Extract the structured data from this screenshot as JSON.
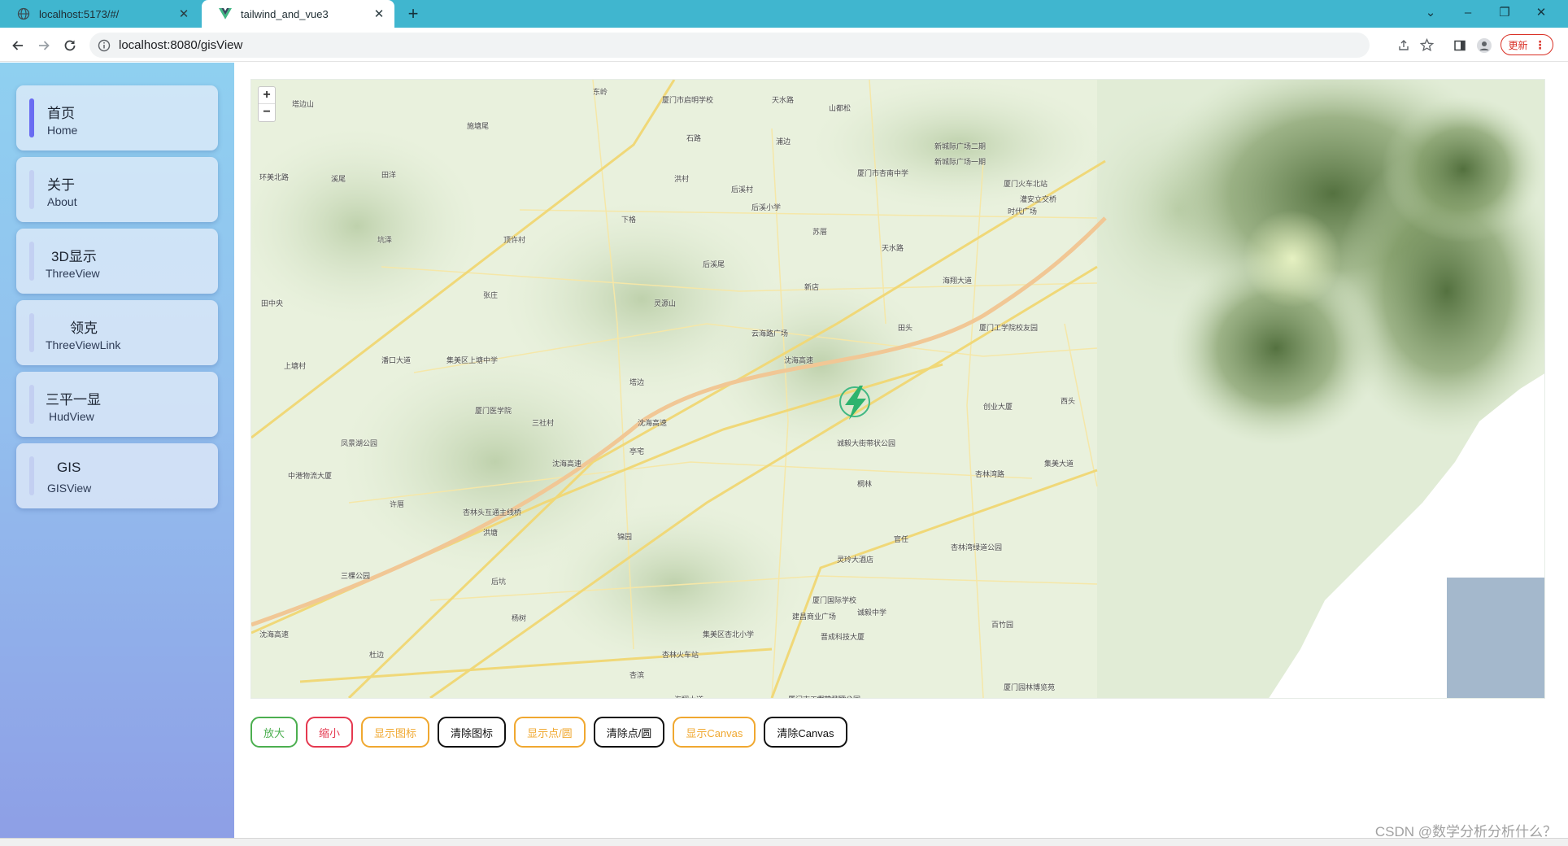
{
  "browser": {
    "tabs": [
      {
        "title": "localhost:5173/#/",
        "active": false
      },
      {
        "title": "tailwind_and_vue3",
        "active": true
      }
    ],
    "address": "localhost:8080/gisView",
    "update_label": "更新"
  },
  "sidebar": {
    "items": [
      {
        "title": "首页",
        "subtitle": "Home",
        "active": true
      },
      {
        "title": "关于",
        "subtitle": "About",
        "active": false
      },
      {
        "title": "3D显示",
        "subtitle": "ThreeView",
        "active": false
      },
      {
        "title": "领克",
        "subtitle": "ThreeViewLink",
        "active": false
      },
      {
        "title": "三平一显",
        "subtitle": "HudView",
        "active": false
      },
      {
        "title": "GIS",
        "subtitle": "GISView",
        "active": false
      }
    ]
  },
  "map": {
    "zoom_in": "+",
    "zoom_out": "−",
    "marker_icon": "lightning-icon",
    "labels": [
      "塔边山",
      "东岭",
      "厦门市启明学校",
      "天水路",
      "山都松",
      "施塘尾",
      "石路",
      "浦边",
      "新城际广场二期",
      "新城际广场一期",
      "厦门市杏南中学",
      "厦门火车北站",
      "灌安立交桥",
      "时代广场",
      "环美北路",
      "溪尾",
      "田洋",
      "后溪村",
      "后溪小学",
      "洪村",
      "苏厝",
      "坑泽",
      "顶许村",
      "下格",
      "天水路",
      "后溪尾",
      "新店",
      "田中央",
      "张庄",
      "灵源山",
      "云海路广场",
      "田头",
      "沈海高速",
      "海翔大道",
      "厦门工学院校友园",
      "上塘村",
      "集美区上塘中学",
      "潘口大道",
      "塔边",
      "厦门医学院",
      "三社村",
      "沈海高速",
      "凤景湖公园",
      "创业大厦",
      "西头",
      "诚毅大街带状公园",
      "亭宅",
      "沈海高速",
      "集美大道",
      "中港物流大厦",
      "许厝",
      "杏林头互通主线桥",
      "桐林",
      "杏林湾路",
      "洪塘",
      "锦园",
      "官任",
      "杏林湾绿道公园",
      "三棵公园",
      "后坑",
      "灵玲大酒店",
      "厦门国际学校",
      "诚毅中学",
      "建昌商业广场",
      "杨树",
      "集美区杏北小学",
      "晋成科技大厦",
      "百竹园",
      "杜边",
      "杏林火车站",
      "沈海高速",
      "杏滨",
      "海翔大道",
      "厦门市工程检测中心",
      "内茂社区公园",
      "厦门园林博览苑"
    ]
  },
  "buttons": [
    {
      "label": "放大",
      "color": "#4caf50"
    },
    {
      "label": "缩小",
      "color": "#e53950"
    },
    {
      "label": "显示图标",
      "color": "#f0a830"
    },
    {
      "label": "清除图标",
      "color": "#111111"
    },
    {
      "label": "显示点/圆",
      "color": "#f0a830"
    },
    {
      "label": "清除点/圆",
      "color": "#111111"
    },
    {
      "label": "显示Canvas",
      "color": "#f0a830"
    },
    {
      "label": "清除Canvas",
      "color": "#111111"
    }
  ],
  "watermark": "CSDN @数学分析分析什么？"
}
